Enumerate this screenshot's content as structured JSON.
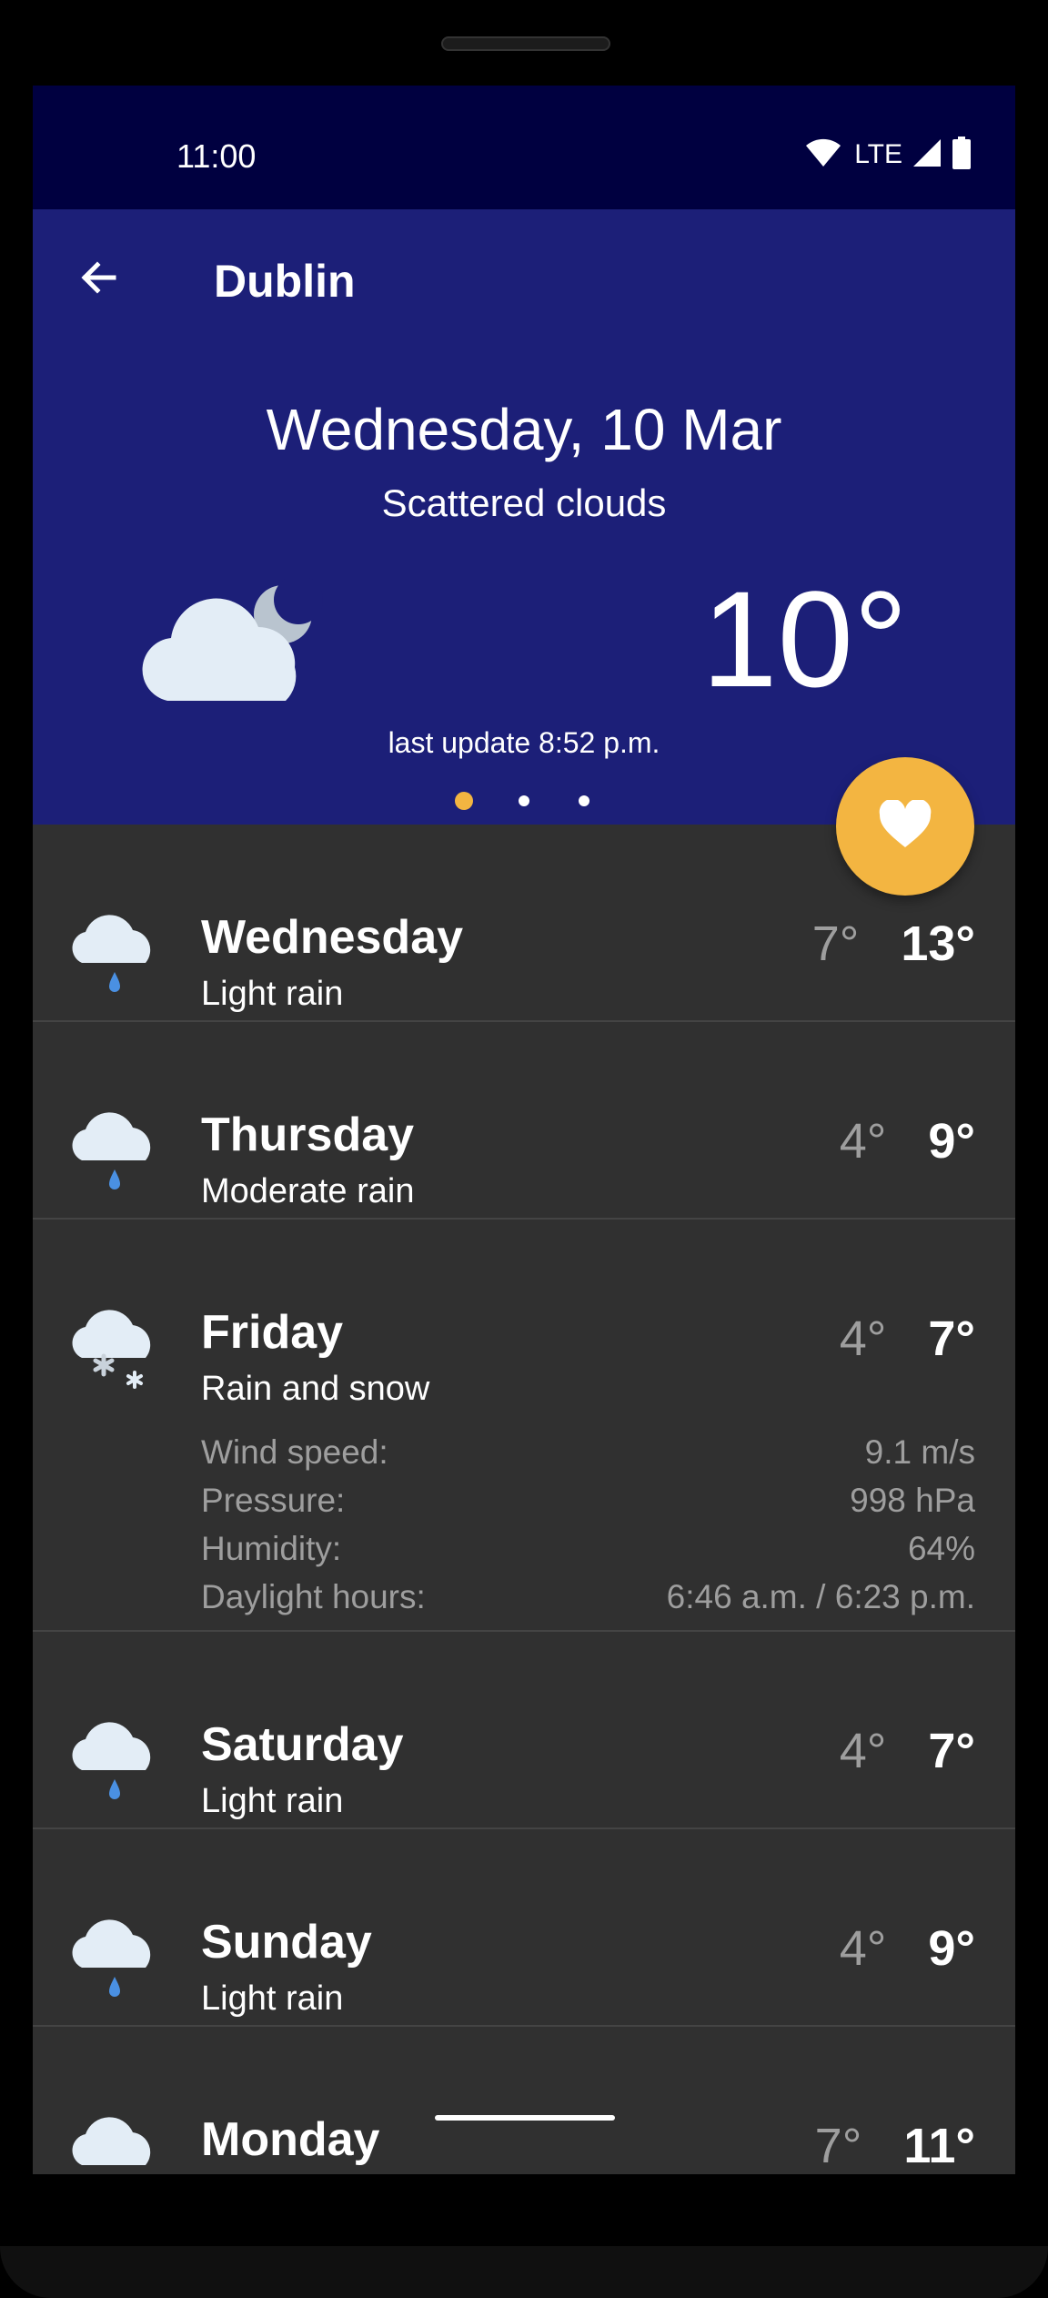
{
  "status_bar": {
    "time": "11:00",
    "network": "LTE",
    "icons": [
      "wifi-icon",
      "signal-icon",
      "battery-icon"
    ]
  },
  "app_bar": {
    "back_icon": "arrow-back-icon",
    "title": "Dublin"
  },
  "current": {
    "date": "Wednesday, 10 Mar",
    "condition": "Scattered clouds",
    "icon": "cloud-moon-icon",
    "temperature": "10°",
    "last_update": "last update 8:52 p.m.",
    "pager": {
      "count": 3,
      "active": 0
    }
  },
  "fab": {
    "icon": "heart-icon"
  },
  "forecast": [
    {
      "day": "Wednesday",
      "condition": "Light rain",
      "icon": "cloud-rain-icon",
      "low": "7°",
      "high": "13°"
    },
    {
      "day": "Thursday",
      "condition": "Moderate rain",
      "icon": "cloud-rain-icon",
      "low": "4°",
      "high": "9°"
    },
    {
      "day": "Friday",
      "condition": "Rain and snow",
      "icon": "cloud-snow-icon",
      "low": "4°",
      "high": "7°",
      "details": [
        {
          "label": "Wind speed:",
          "value": "9.1 m/s"
        },
        {
          "label": "Pressure:",
          "value": "998 hPa"
        },
        {
          "label": "Humidity:",
          "value": "64%"
        },
        {
          "label": "Daylight hours:",
          "value": "6:46 a.m. / 6:23 p.m."
        }
      ]
    },
    {
      "day": "Saturday",
      "condition": "Light rain",
      "icon": "cloud-rain-icon",
      "low": "4°",
      "high": "7°"
    },
    {
      "day": "Sunday",
      "condition": "Light rain",
      "icon": "cloud-rain-icon",
      "low": "4°",
      "high": "9°"
    },
    {
      "day": "Monday",
      "condition": "",
      "icon": "cloud-rain-icon",
      "low": "7°",
      "high": "11°"
    }
  ],
  "colors": {
    "status_bar": "#000040",
    "primary": "#1c1f78",
    "accent": "#f3b541",
    "list_background": "#303030",
    "rain_drop": "#4a90e2"
  }
}
